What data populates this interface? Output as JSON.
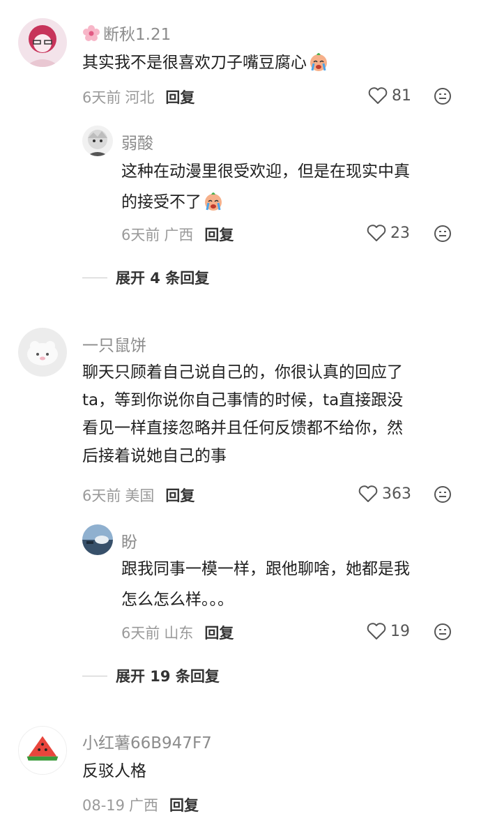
{
  "comments": [
    {
      "user": "断秋1.21",
      "text": "其实我不是很喜欢刀子嘴豆腐心",
      "time": "6天前",
      "location": "河北",
      "reply_label": "回复",
      "likes": "81",
      "replies": [
        {
          "user": "弱酸",
          "text_line1": "这种在动漫里很受欢迎，但是在现实中真",
          "text_line2": "的接受不了",
          "time": "6天前",
          "location": "广西",
          "reply_label": "回复",
          "likes": "23"
        }
      ],
      "expand_label": "展开 4 条回复"
    },
    {
      "user": "一只鼠饼",
      "text_lines": [
        "聊天只顾着自己说自己的，你很认真的回应了",
        "ta，等到你说你自己事情的时候，ta直接跟没",
        "看见一样直接忽略并且任何反馈都不给你，然",
        "后接着说她自己的事"
      ],
      "time": "6天前",
      "location": "美国",
      "reply_label": "回复",
      "likes": "363",
      "replies": [
        {
          "user": "盼",
          "text_line1": "跟我同事一模一样，跟他聊啥，她都是我",
          "text_line2": "怎么怎么样。。。",
          "time": "6天前",
          "location": "山东",
          "reply_label": "回复",
          "likes": "19"
        }
      ],
      "expand_label": "展开 19 条回复"
    },
    {
      "user": "小红薯66B947F7",
      "text": "反驳人格",
      "time": "08-19",
      "location": "广西",
      "reply_label": "回复"
    }
  ],
  "icons": {
    "like": "heart-outline-icon",
    "menu": "emoji-face-icon"
  },
  "colors": {
    "username": "#8c8c8c",
    "meta": "#9a9a9a",
    "text": "#1f1f1f",
    "watermelon_red": "#e8453c",
    "watermelon_green": "#3a9a3a"
  }
}
